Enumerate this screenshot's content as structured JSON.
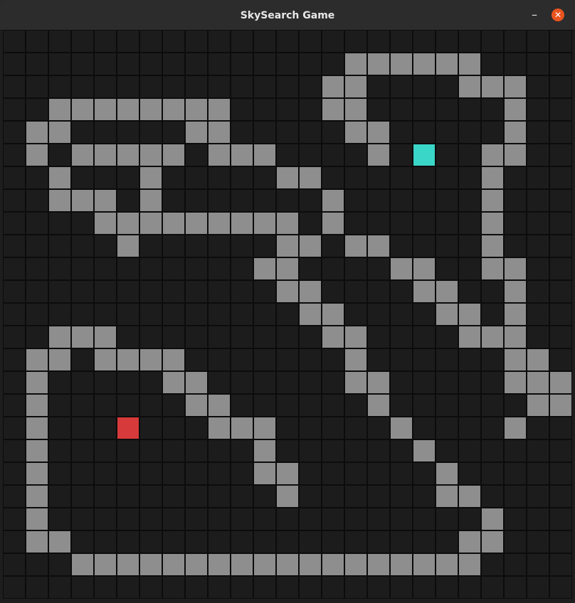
{
  "window": {
    "title": "SkySearch Game",
    "minimize_symbol": "–",
    "close_symbol": "✕"
  },
  "board": {
    "rows": 25,
    "cols": 25,
    "legend": {
      "0": "empty",
      "1": "wall",
      "2": "goal",
      "3": "player"
    },
    "colors": {
      "empty": "#1c1c1c",
      "wall": "#8e8e8e",
      "goal": "#3ad6c8",
      "player": "#d73a3a",
      "grid_line": "#0c0c0c"
    },
    "grid": [
      "0000000000000000000000000",
      "0000000000000001111110000",
      "0000000000000011000011100",
      "0011111111000011000000100",
      "0110000011000001100000100",
      "0101111101110000102001100",
      "0010001000001100000001000",
      "0011101000000010000001000",
      "0000111111111010000001000",
      "0000010000001101100001000",
      "0000000000011000011001100",
      "0000000000001100001100100",
      "0000000000000110000110100",
      "0011100000000011000011100",
      "0110111100000001000000110",
      "0100000110000001100000111",
      "0100000011000000100000011",
      "0100030001110000010000100",
      "0100000000010000001000000",
      "0100000000011000000100000",
      "0100000000001000000110000",
      "0100000000000000000001000",
      "0110000000000000000011000",
      "0001111111111111111110000",
      "0000000000000000000000000"
    ]
  }
}
